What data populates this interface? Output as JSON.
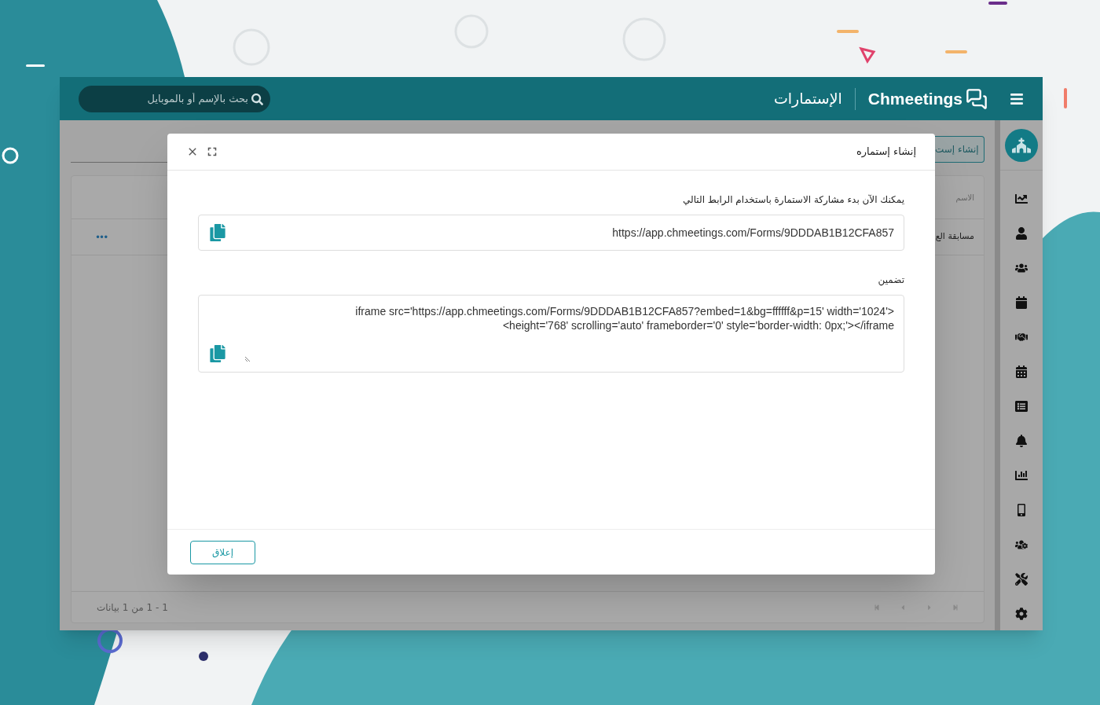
{
  "header": {
    "brand": "Chmeetings",
    "title": "الإستمارات",
    "search": {
      "placeholder": "بحث بالإسم أو بالموبايل"
    }
  },
  "page": {
    "create_button": "إنشاء إست",
    "table": {
      "columns": [
        "الاسم"
      ],
      "rows": [
        {
          "name": "مسابقة الع",
          "actions": "•••"
        }
      ]
    },
    "pagination": "1 - 1 من 1 بيانات"
  },
  "dialog": {
    "title": "إنشاء إستماره",
    "link_label": "يمكنك الآن بدء مشاركة الاستمارة باستخدام الرابط التالي",
    "link": "https://app.chmeetings.com/Forms/9DDDAB1B12CFA857",
    "embed_label": "تضمين",
    "embed_lines": [
      "iframe src='https://app.chmeetings.com/Forms/9DDDAB1B12CFA857?embed=1&bg=ffffff&p=15' width='1024'>",
      "<height='768' scrolling='auto' frameborder='0' style='border-width: 0px;'></iframe"
    ],
    "close_button": "إعلاق"
  }
}
